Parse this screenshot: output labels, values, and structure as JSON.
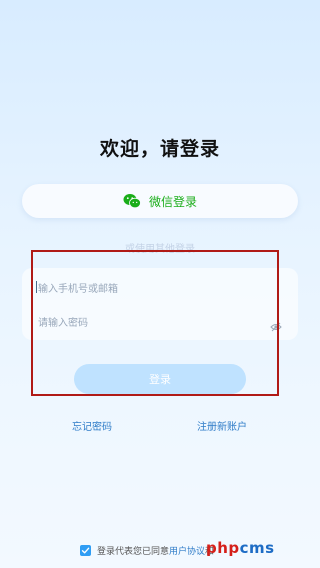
{
  "title": "欢迎，请登录",
  "wechat_login": {
    "label": "微信登录"
  },
  "other_login_text": "或使用其他登录",
  "account_field": {
    "placeholder": "输入手机号或邮箱"
  },
  "password_field": {
    "placeholder": "请输入密码"
  },
  "login_button": {
    "label": "登录"
  },
  "links": {
    "forgot_password": "忘记密码",
    "register": "注册新账户"
  },
  "agreement": {
    "text": "登录代表您已同意",
    "user_agreement": "用户协议",
    "and": "和"
  },
  "watermark": {
    "part1": "php",
    "part2": "cms"
  },
  "colors": {
    "wechat_green": "#1aad19",
    "link_blue": "#2f7cc8",
    "login_button": "#bfe2ff",
    "highlight_box": "#b01a16",
    "checkbox": "#2f9df4",
    "watermark_red": "#d51f19",
    "watermark_blue": "#1d6cc5"
  },
  "icons": {
    "wechat": "wechat-icon",
    "password_visibility": "eye-hidden-icon",
    "checkbox": "checkmark-icon"
  }
}
